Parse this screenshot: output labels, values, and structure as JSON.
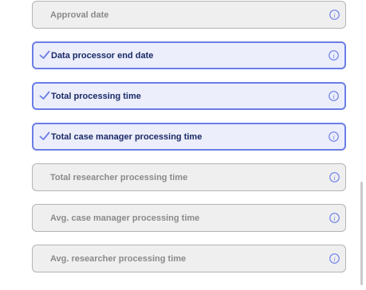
{
  "colors": {
    "selected_border": "#6b7ee6",
    "selected_bg": "#eceefc",
    "selected_text": "#1a2a66",
    "unselected_border": "#b4b4b4",
    "unselected_bg": "#efeff0",
    "unselected_text": "#8a8a8a",
    "icon_color": "#6b7ee6"
  },
  "options": [
    {
      "label": "Approval date",
      "selected": false,
      "icon": "info-icon"
    },
    {
      "label": "Data processor end date",
      "selected": true,
      "icon": "info-icon"
    },
    {
      "label": "Total processing time",
      "selected": true,
      "icon": "info-icon"
    },
    {
      "label": "Total case manager processing time",
      "selected": true,
      "icon": "info-icon"
    },
    {
      "label": "Total researcher processing time",
      "selected": false,
      "icon": "info-icon"
    },
    {
      "label": "Avg. case manager processing time",
      "selected": false,
      "icon": "info-icon"
    },
    {
      "label": "Avg. researcher processing time",
      "selected": false,
      "icon": "info-icon"
    }
  ]
}
